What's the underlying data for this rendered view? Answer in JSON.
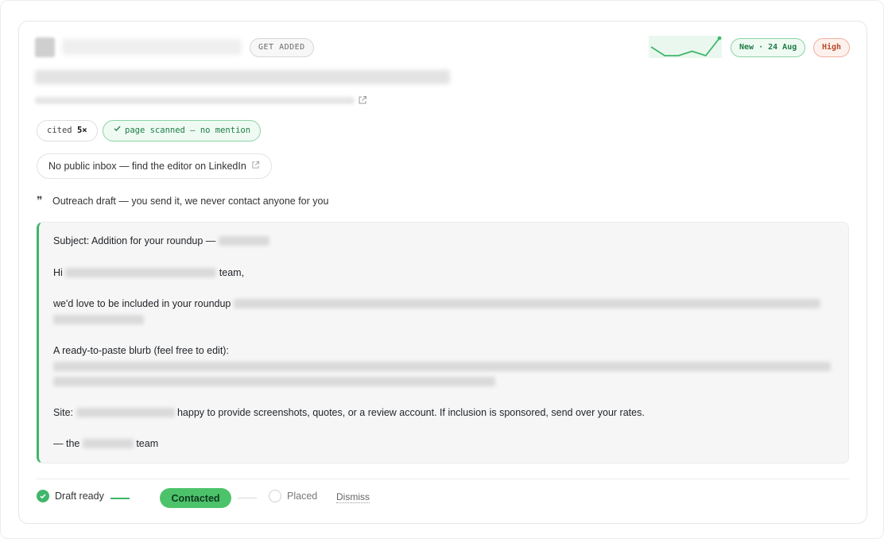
{
  "header": {
    "tag_label": "GET ADDED",
    "status_badge": "New · 24 Aug",
    "priority_badge": "High",
    "colors": {
      "accent_green": "#3fb66b",
      "priority_red": "#b84a2c"
    }
  },
  "sparkline": {
    "values": [
      3,
      5,
      5,
      4,
      5,
      1
    ]
  },
  "chips": {
    "cited_prefix": "cited",
    "cited_count": "5×",
    "scanned_label": "page scanned — no mention",
    "inbox_label": "No public inbox — find the editor on LinkedIn"
  },
  "outreach": {
    "heading": "Outreach draft — you send it, we never contact anyone for you",
    "subject_prefix": "Subject: Addition for your roundup —",
    "greeting_hi": "Hi",
    "greeting_team": "team,",
    "intro": "we'd love to be included in your roundup",
    "blurb_intro": "A ready-to-paste blurb (feel free to edit):",
    "site_label": "Site:",
    "site_tail": "happy to provide screenshots, quotes, or a review account. If inclusion is sponsored, send over your rates.",
    "signoff_prefix": "— the",
    "signoff_suffix": "team"
  },
  "pipeline": {
    "stage1": "Draft ready",
    "stage2": "Contacted",
    "stage3": "Placed",
    "dismiss": "Dismiss"
  },
  "icons": {
    "check": "check-icon",
    "external": "external-link-icon",
    "quote": "quote-icon"
  }
}
